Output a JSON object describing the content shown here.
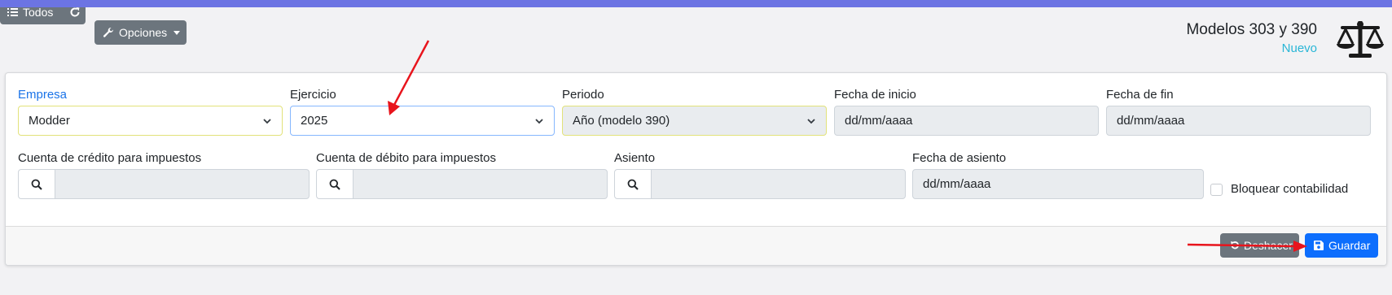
{
  "toolbar": {
    "todos_label": "Todos",
    "opciones_label": "Opciones"
  },
  "header": {
    "title": "Modelos 303 y 390",
    "subtitle": "Nuevo"
  },
  "form": {
    "empresa": {
      "label": "Empresa",
      "value": "Modder"
    },
    "ejercicio": {
      "label": "Ejercicio",
      "value": "2025"
    },
    "periodo": {
      "label": "Periodo",
      "value": "Año (modelo 390)"
    },
    "fecha_inicio": {
      "label": "Fecha de inicio",
      "placeholder": "dd/mm/aaaa"
    },
    "fecha_fin": {
      "label": "Fecha de fin",
      "placeholder": "dd/mm/aaaa"
    },
    "cuenta_credito": {
      "label": "Cuenta de crédito para impuestos"
    },
    "cuenta_debito": {
      "label": "Cuenta de débito para impuestos"
    },
    "asiento": {
      "label": "Asiento"
    },
    "fecha_asiento": {
      "label": "Fecha de asiento",
      "placeholder": "dd/mm/aaaa"
    },
    "bloquear": {
      "label": "Bloquear contabilidad",
      "checked": false
    }
  },
  "footer": {
    "deshacer_label": "Deshacer",
    "guardar_label": "Guardar"
  },
  "colors": {
    "topbar": "#6c74e3",
    "primary": "#0d6efd",
    "secondary": "#6c757d",
    "annotation_arrow": "#e8141c",
    "subtitle": "#29b6d6"
  }
}
